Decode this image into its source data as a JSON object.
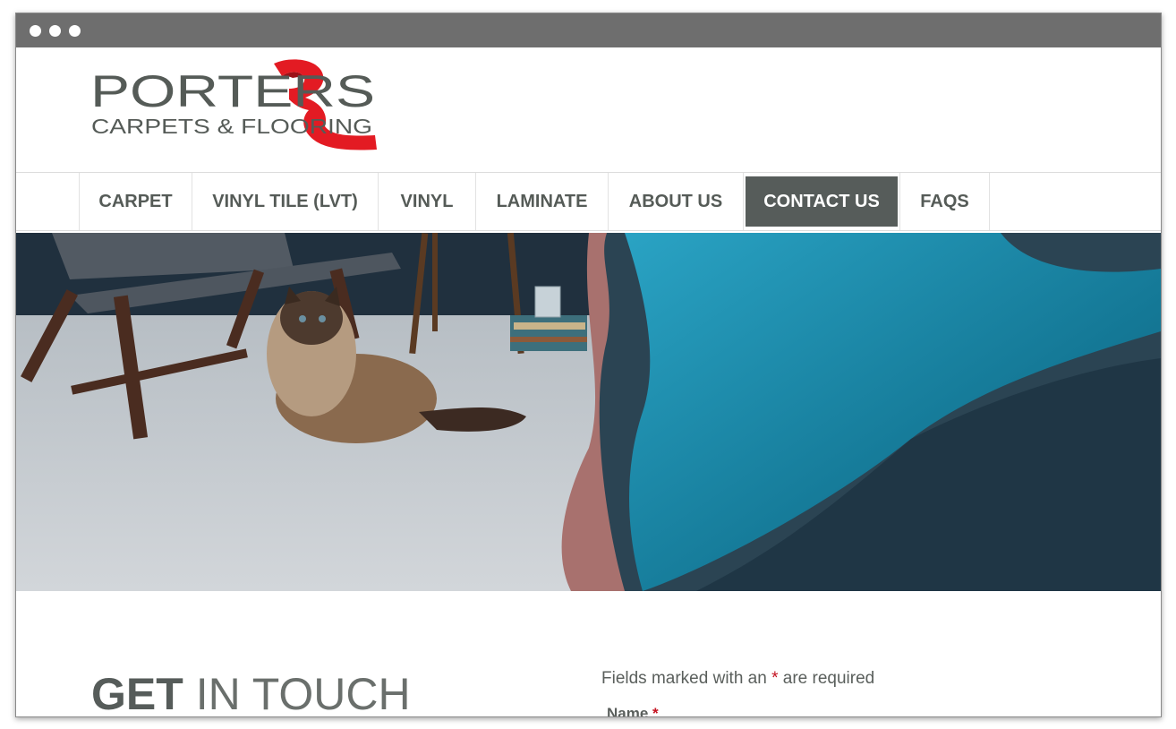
{
  "window": {
    "controls": [
      "dot",
      "dot",
      "dot"
    ]
  },
  "logo": {
    "word": "PORTERS",
    "tagline": "CARPETS & FLOORING",
    "brand_color": "#e31b23",
    "text_color": "#555b57"
  },
  "nav": {
    "items": [
      {
        "label": "CARPET",
        "active": false
      },
      {
        "label": "VINYL TILE (LVT)",
        "active": false
      },
      {
        "label": "VINYL",
        "active": false
      },
      {
        "label": "LAMINATE",
        "active": false
      },
      {
        "label": "ABOUT US",
        "active": false
      },
      {
        "label": "CONTACT US",
        "active": true
      },
      {
        "label": "FAQS",
        "active": false
      }
    ],
    "active_bg": "#565c5a"
  },
  "contact": {
    "headline_bold": "GET",
    "headline_light": "IN TOUCH",
    "required_note_before": "Fields marked with an",
    "required_star": "*",
    "required_note_after": "are required",
    "name_label": "Name",
    "name_star": "*"
  }
}
